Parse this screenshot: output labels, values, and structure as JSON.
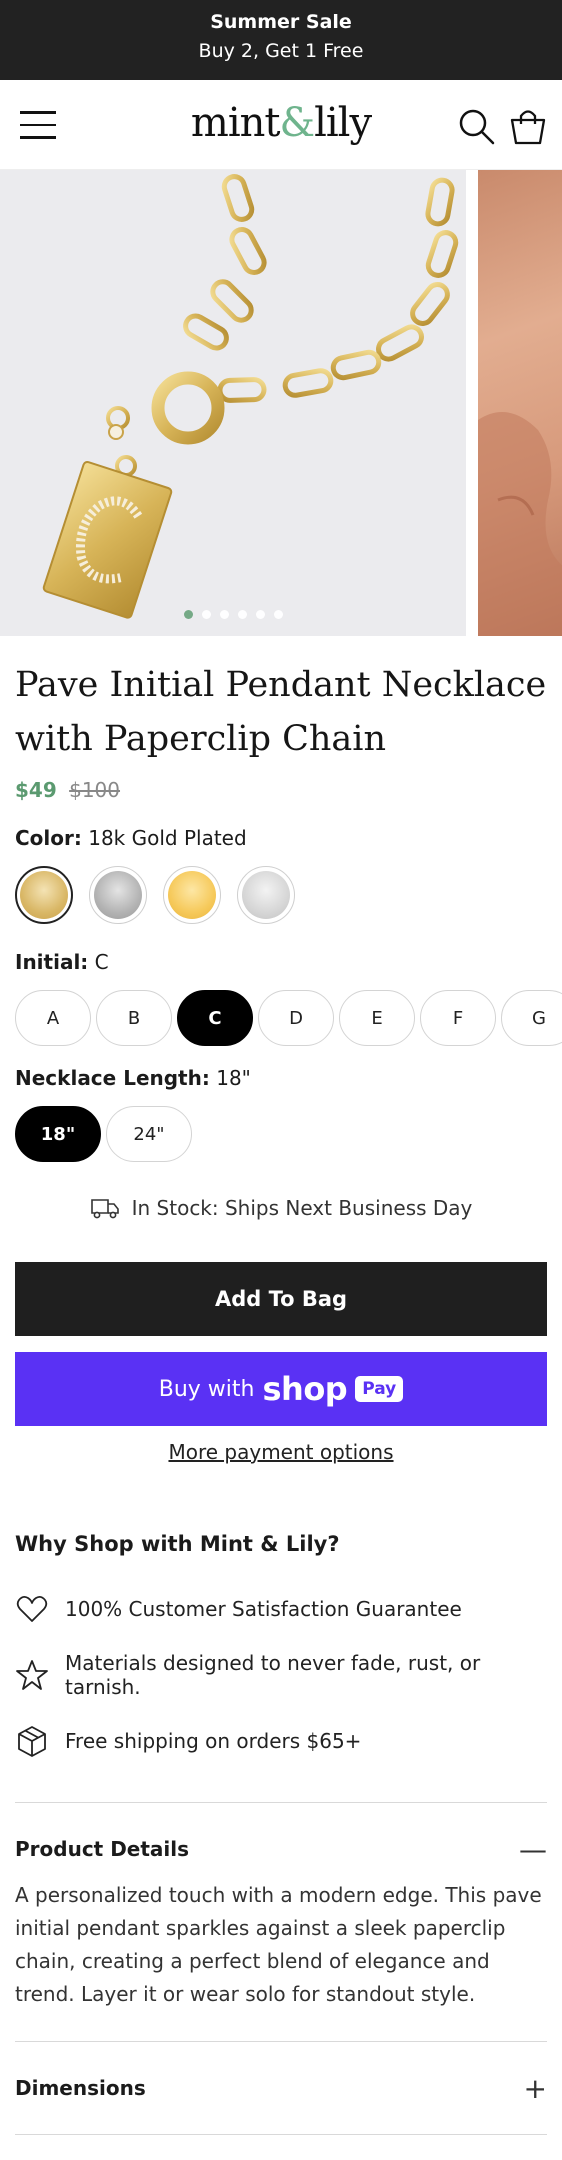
{
  "announcement": {
    "title": "Summer Sale",
    "subtitle": "Buy 2, Get 1 Free"
  },
  "header": {
    "logo_left": "mint",
    "logo_amp": "&",
    "logo_right": "lily",
    "menu_icon": "hamburger-icon",
    "search_icon": "search-icon",
    "bag_icon": "bag-icon"
  },
  "gallery": {
    "slide_count": 6,
    "active_index": 0
  },
  "product": {
    "title": "Pave Initial Pendant Necklace with Paperclip Chain",
    "price": "$49",
    "compare_price": "$100"
  },
  "color": {
    "label": "Color:",
    "value": "18k Gold Plated",
    "swatches": [
      {
        "name": "gold",
        "color": "#e6c98a",
        "selected": true
      },
      {
        "name": "silver",
        "color": "#b9b9b9",
        "selected": false
      },
      {
        "name": "yellow-gold",
        "color": "#f7cf6a",
        "selected": false
      },
      {
        "name": "light-silver",
        "color": "#d7d7d7",
        "selected": false
      }
    ]
  },
  "initial": {
    "label": "Initial:",
    "value": "C",
    "options": [
      "A",
      "B",
      "C",
      "D",
      "E",
      "F",
      "G"
    ]
  },
  "length": {
    "label": "Necklace Length:",
    "value": "18\"",
    "options": [
      "18\"",
      "24\""
    ]
  },
  "stock": {
    "text": "In Stock: Ships Next Business Day"
  },
  "buttons": {
    "add_to_bag": "Add To Bag",
    "buy_with": "Buy with",
    "shop": "shop",
    "pay": "Pay",
    "more_payment": "More payment options"
  },
  "why": {
    "title": "Why Shop with Mint & Lily?",
    "items": [
      {
        "icon": "heart-icon",
        "text": "100% Customer Satisfaction Guarantee"
      },
      {
        "icon": "star-icon",
        "text": "Materials designed to never fade, rust, or tarnish."
      },
      {
        "icon": "box-icon",
        "text": "Free shipping on orders $65+"
      }
    ]
  },
  "details": {
    "title": "Product Details",
    "sign": "—",
    "body": "A personalized touch with a modern edge. This pave initial pendant sparkles against a sleek paperclip chain, creating a perfect blend of elegance and trend. Layer it or wear solo for standout style."
  },
  "dimensions": {
    "title": "Dimensions",
    "sign": "+"
  },
  "colors": {
    "accent_green": "#5b9a70",
    "shop_purple": "#5a31f4",
    "dark": "#1f1f1f"
  }
}
